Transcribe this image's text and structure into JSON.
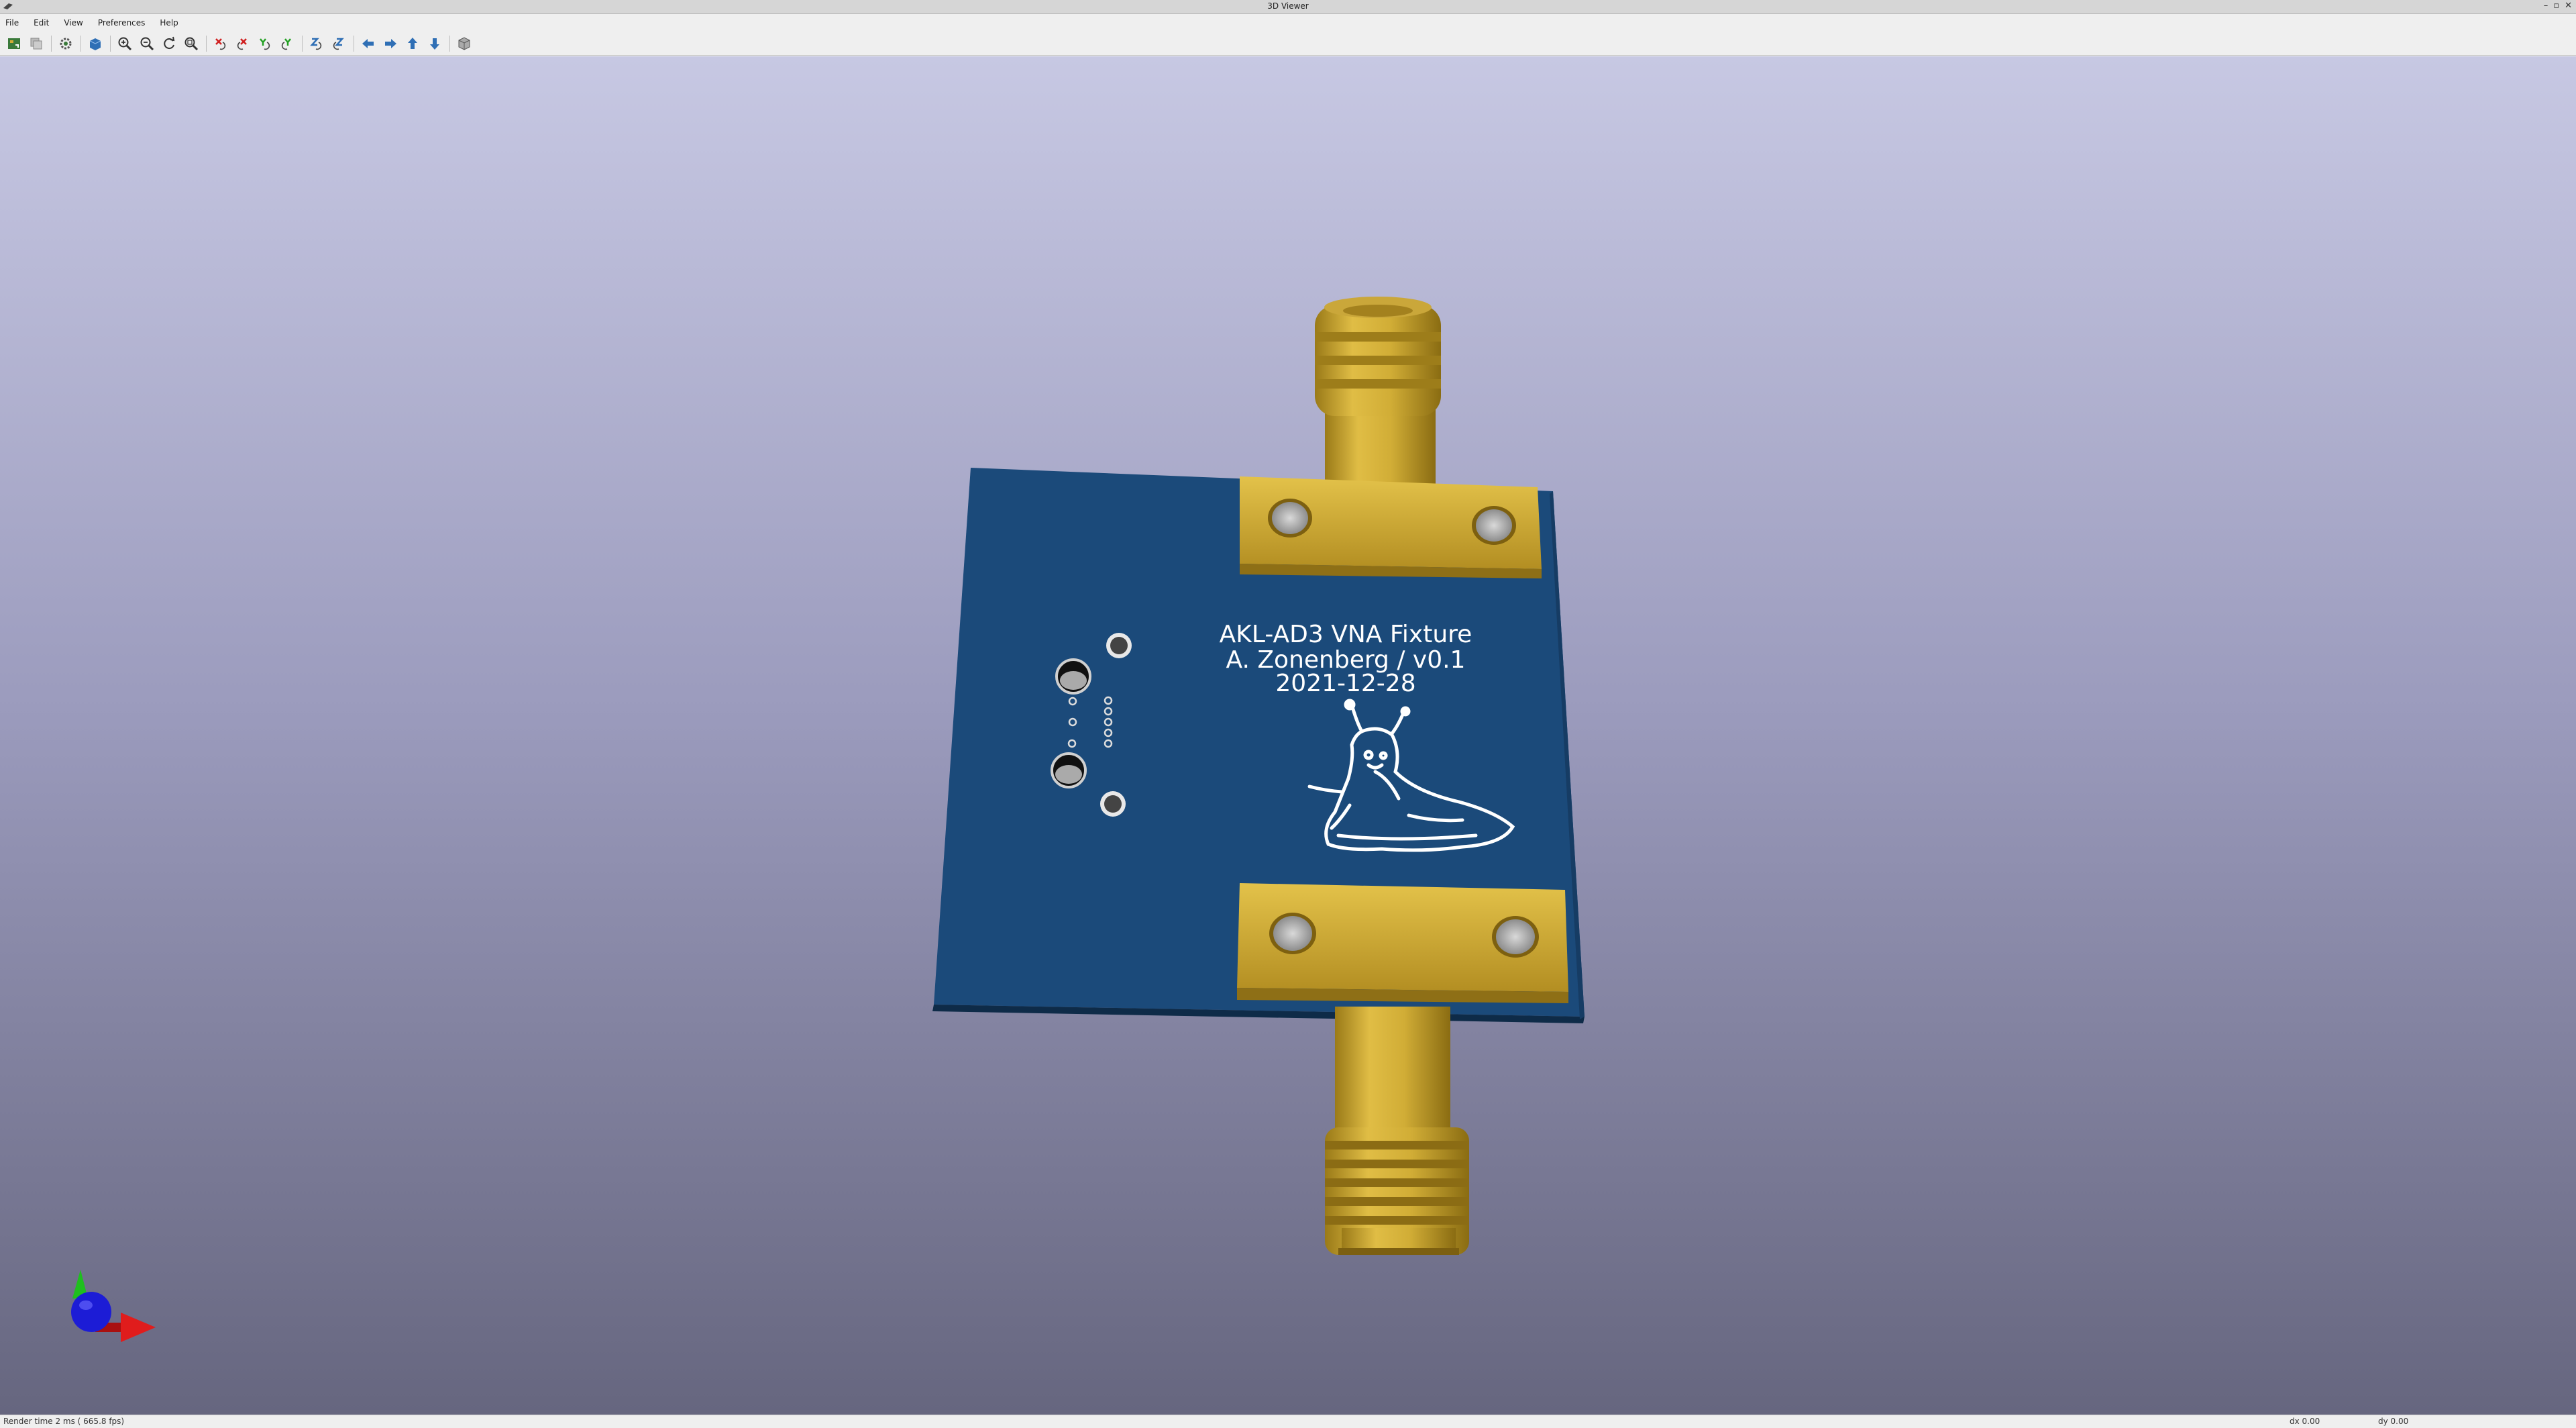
{
  "window": {
    "title": "3D Viewer"
  },
  "menu": [
    "File",
    "Edit",
    "View",
    "Preferences",
    "Help"
  ],
  "toolbar": [
    {
      "name": "reload-board-icon"
    },
    {
      "name": "copy-image-icon"
    },
    {
      "name": "settings-icon"
    },
    {
      "name": "raytracing-icon"
    },
    {
      "name": "zoom-in-icon"
    },
    {
      "name": "zoom-out-icon"
    },
    {
      "name": "redraw-icon"
    },
    {
      "name": "zoom-fit-icon"
    },
    {
      "name": "rotate-x-cw-icon"
    },
    {
      "name": "rotate-x-ccw-icon"
    },
    {
      "name": "rotate-y-cw-icon"
    },
    {
      "name": "rotate-y-ccw-icon"
    },
    {
      "name": "rotate-z-cw-icon"
    },
    {
      "name": "rotate-z-ccw-icon"
    },
    {
      "name": "pan-left-icon"
    },
    {
      "name": "pan-right-icon"
    },
    {
      "name": "pan-up-icon"
    },
    {
      "name": "pan-down-icon"
    },
    {
      "name": "toggle-ortho-icon"
    }
  ],
  "board": {
    "silkscreen": [
      "AKL-AD3 VNA Fixture",
      "A. Zonenberg / v0.1",
      "2021-12-28"
    ],
    "pcb_color": "#1b4a7a",
    "connector_color": "#d1ad36",
    "silk_color": "#ffffff"
  },
  "axes": {
    "x_color": "#e01c1c",
    "y_color": "#1fbf1f",
    "z_color": "#1c1cd6"
  },
  "status": {
    "render_time": "Render time 2 ms ( 665.8 fps)",
    "dx": "dx 0.00",
    "dy": "dy 0.00"
  }
}
